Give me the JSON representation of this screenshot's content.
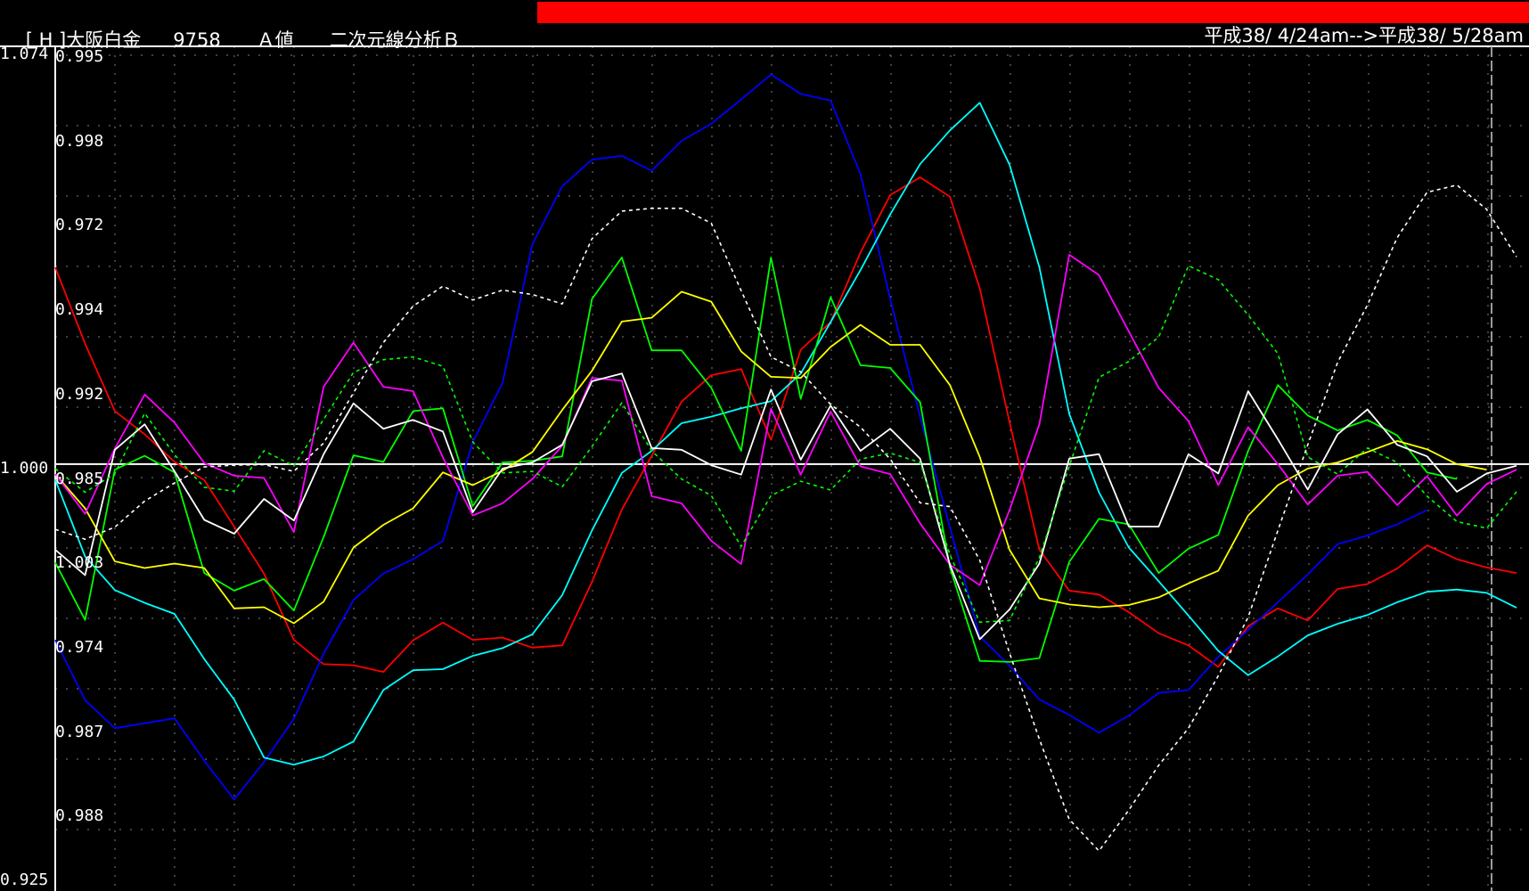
{
  "title_bar": {
    "bracket": "[ H ]",
    "name": "大阪白金",
    "code": "9758",
    "value_type": "Ａ値",
    "method": "二次元線分析Ｂ"
  },
  "date_range": "平成38/ 4/24am-->平成38/ 5/28am",
  "colors": {
    "background": "#000000",
    "header_bar": "#ff0000",
    "grid": "#7f7f7f",
    "reference_line": "#ffffff"
  },
  "chart_data": {
    "type": "line",
    "title": "",
    "xlabel": "",
    "ylabel": "",
    "grid": true,
    "y_left_labels": [
      "1.074",
      "1.000",
      "0.925"
    ],
    "y_left_values": [
      1.074,
      1.0,
      0.925
    ],
    "y_inner_labels": [
      "0.995",
      "0.998",
      "0.972",
      "0.994",
      "0.992",
      "0.985",
      "1.003",
      "0.974",
      "0.987",
      "0.988"
    ],
    "ylim": [
      0.925,
      1.074
    ],
    "x_count": 50,
    "reference_value": 1.0,
    "series": [
      {
        "color": "#ff0000",
        "dash": false,
        "values": [
          1.0356,
          1.0218,
          1.0096,
          1.0054,
          1.0004,
          0.9971,
          0.9887,
          0.9802,
          0.9682,
          0.9638,
          0.9636,
          0.9624,
          0.9681,
          0.9713,
          0.9682,
          0.9686,
          0.9668,
          0.9672,
          0.9787,
          0.9918,
          1.0015,
          1.0113,
          1.0161,
          1.0172,
          1.0044,
          1.0207,
          1.0257,
          1.0383,
          1.0487,
          1.0519,
          1.0484,
          1.0318,
          1.0076,
          0.9845,
          0.9771,
          0.9764,
          0.9732,
          0.9694,
          0.9672,
          0.9633,
          0.9707,
          0.9739,
          0.9717,
          0.9774,
          0.9783,
          0.9811,
          0.9853,
          0.9828,
          0.9813,
          0.9803
        ]
      },
      {
        "color": "#0000ff",
        "dash": false,
        "values": [
          0.9682,
          0.9573,
          0.9522,
          0.9531,
          0.954,
          0.9463,
          0.9393,
          0.9461,
          0.9539,
          0.9657,
          0.9754,
          0.9802,
          0.9828,
          0.9861,
          1.004,
          1.0147,
          1.0398,
          1.0503,
          1.0551,
          1.0558,
          1.0531,
          1.0585,
          1.0616,
          1.066,
          1.0705,
          1.067,
          1.0658,
          1.0525,
          1.0299,
          1.0086,
          0.9886,
          0.9688,
          0.9635,
          0.9574,
          0.9546,
          0.9514,
          0.9545,
          0.9586,
          0.9591,
          0.9651,
          0.97,
          0.975,
          0.98,
          0.9855,
          0.9871,
          0.9891,
          0.9917
        ]
      },
      {
        "color": "#00ffff",
        "dash": false,
        "values": [
          0.9972,
          0.9833,
          0.9772,
          0.9749,
          0.9729,
          0.9647,
          0.9574,
          0.9469,
          0.9456,
          0.9471,
          0.9498,
          0.9591,
          0.9627,
          0.9629,
          0.9653,
          0.9667,
          0.9692,
          0.9763,
          0.988,
          0.9984,
          1.0024,
          1.0074,
          1.0086,
          1.0101,
          1.0114,
          1.0164,
          1.0257,
          1.0351,
          1.0452,
          1.0543,
          1.0604,
          1.0654,
          1.0542,
          1.0356,
          1.0091,
          0.9949,
          0.9849,
          0.9788,
          0.9726,
          0.9662,
          0.9618,
          0.9652,
          0.969,
          0.9711,
          0.9727,
          0.975,
          0.9769,
          0.9773,
          0.9767,
          0.974
        ]
      },
      {
        "color": "#00ff00",
        "dash": false,
        "values": [
          0.9822,
          0.9718,
          0.999,
          1.0015,
          0.9985,
          0.9803,
          0.9771,
          0.9792,
          0.9735,
          0.9868,
          1.0016,
          1.0004,
          1.0096,
          1.0101,
          0.9924,
          1.0003,
          1.0006,
          1.0014,
          1.0299,
          1.0374,
          1.0206,
          1.0206,
          1.0138,
          1.0024,
          1.0374,
          1.0118,
          1.0302,
          1.0179,
          1.0174,
          1.0112,
          0.9813,
          0.9644,
          0.9642,
          0.9649,
          0.9823,
          0.9901,
          0.9891,
          0.9803,
          0.9847,
          0.9872,
          1.0024,
          1.0143,
          1.0088,
          1.0061,
          1.008,
          1.0052,
          0.9985,
          0.9973
        ]
      },
      {
        "color": "#ffff00",
        "dash": false,
        "values": [
          0.9982,
          0.992,
          0.9824,
          0.9812,
          0.982,
          0.9812,
          0.9739,
          0.9741,
          0.9712,
          0.9751,
          0.9849,
          0.989,
          0.992,
          0.9985,
          0.9962,
          0.9988,
          1.0022,
          1.0098,
          1.0169,
          1.0258,
          1.0265,
          1.0312,
          1.0294,
          1.0204,
          1.0158,
          1.0156,
          1.0212,
          1.0252,
          1.0216,
          1.0216,
          1.0143,
          1.0013,
          0.9845,
          0.9757,
          0.9746,
          0.9741,
          0.9745,
          0.9759,
          0.9784,
          0.9807,
          0.9907,
          0.9962,
          0.9992,
          1.0003,
          1.0022,
          1.0042,
          1.0027,
          1.0,
          0.999
        ]
      },
      {
        "color": "#ff00ff",
        "dash": false,
        "values": [
          0.9982,
          0.991,
          1.0028,
          1.0126,
          1.0075,
          1.0002,
          0.9979,
          0.9975,
          0.9877,
          1.014,
          1.022,
          1.014,
          1.0132,
          1.0012,
          0.9907,
          0.9929,
          0.9973,
          1.0033,
          1.0156,
          1.0151,
          0.9942,
          0.9929,
          0.9861,
          0.9819,
          1.01,
          0.9981,
          1.0095,
          0.9996,
          0.9982,
          0.9893,
          0.9818,
          0.9781,
          0.9917,
          1.0072,
          1.0379,
          1.0342,
          1.024,
          1.0138,
          1.0078,
          0.9962,
          1.0067,
          1.0,
          0.9927,
          0.9979,
          0.9986,
          0.9926,
          0.9978,
          0.9907,
          0.9964,
          0.999
        ]
      },
      {
        "color": "#ffffff",
        "dash": false,
        "values": [
          0.9845,
          0.9799,
          1.0026,
          1.0072,
          0.9987,
          0.9899,
          0.9874,
          0.9937,
          0.9898,
          1.0018,
          1.011,
          1.0064,
          1.008,
          1.0059,
          0.9913,
          0.9992,
          1.0003,
          1.0035,
          1.015,
          1.0164,
          1.0029,
          1.0026,
          0.9998,
          0.9981,
          1.0135,
          1.0008,
          1.0106,
          1.0024,
          1.0064,
          1.001,
          0.9818,
          0.9683,
          0.9737,
          0.982,
          1.001,
          1.0018,
          0.9887,
          0.9887,
          1.0018,
          0.9983,
          1.0132,
          1.0045,
          0.9954,
          1.0054,
          1.0099,
          1.0035,
          1.0014,
          0.995,
          0.9983,
          0.9997
        ]
      },
      {
        "color": "#00ff00",
        "dash": true,
        "values": [
          0.9992,
          0.9949,
          0.9983,
          1.0092,
          1.0017,
          0.9958,
          0.9951,
          1.0024,
          0.9997,
          1.0081,
          1.0166,
          1.0189,
          1.0194,
          1.0177,
          1.004,
          0.9984,
          0.9987,
          0.9959,
          1.0032,
          1.0111,
          1.0024,
          0.9973,
          0.9943,
          0.9851,
          0.9943,
          0.9969,
          0.9953,
          1.0009,
          1.002,
          1.0003,
          0.9836,
          0.9714,
          0.9717,
          0.9831,
          0.9996,
          1.0157,
          1.0186,
          1.023,
          1.0359,
          1.0334,
          1.027,
          1.02,
          1.0013,
          0.9982,
          1.0029,
          1.0003,
          0.9942,
          0.9896,
          0.9884,
          0.995
        ]
      },
      {
        "color": "#ffffff",
        "dash": true,
        "values": [
          0.9882,
          0.9864,
          0.9886,
          0.9933,
          0.9966,
          0.9995,
          0.9998,
          0.9999,
          0.9987,
          1.0038,
          1.0129,
          1.022,
          1.0286,
          1.0322,
          1.0297,
          1.0315,
          1.0307,
          1.029,
          1.0408,
          1.0458,
          1.0463,
          1.0463,
          1.0436,
          1.0314,
          1.0194,
          1.0167,
          1.0108,
          1.0067,
          1.0009,
          0.993,
          0.9923,
          0.9826,
          0.9658,
          0.9502,
          0.9357,
          0.93,
          0.9374,
          0.9455,
          0.9522,
          0.9617,
          0.9723,
          0.988,
          1.0035,
          1.0184,
          1.0288,
          1.041,
          1.0492,
          1.0505,
          1.0461,
          1.0375
        ]
      }
    ]
  }
}
